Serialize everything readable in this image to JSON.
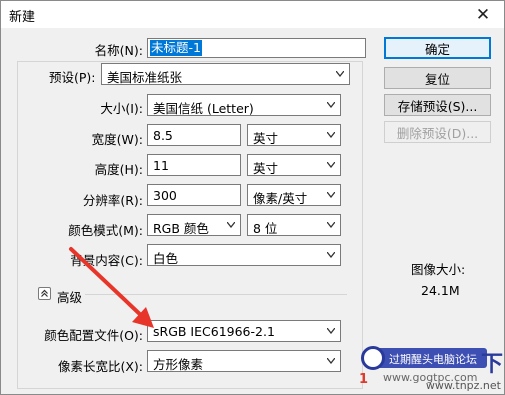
{
  "window": {
    "title": "新建",
    "close_glyph": "✕"
  },
  "form": {
    "name": {
      "label": "名称(N):",
      "value": "未标题-1"
    },
    "preset": {
      "label": "预设(P):",
      "value": "美国标准纸张"
    },
    "size": {
      "label": "大小(I):",
      "value": "美国信纸 (Letter)"
    },
    "width": {
      "label": "宽度(W):",
      "value": "8.5",
      "unit": "英寸"
    },
    "height": {
      "label": "高度(H):",
      "value": "11",
      "unit": "英寸"
    },
    "resolution": {
      "label": "分辨率(R):",
      "value": "300",
      "unit": "像素/英寸"
    },
    "color_mode": {
      "label": "颜色模式(M):",
      "value": "RGB 颜色",
      "depth": "8 位"
    },
    "background": {
      "label": "背景内容(C):",
      "value": "白色"
    },
    "advanced": {
      "label": "高级",
      "icon": "chevron-up-icon"
    },
    "color_profile": {
      "label": "颜色配置文件(O):",
      "value": "sRGB IEC61966-2.1"
    },
    "pixel_aspect": {
      "label": "像素长宽比(X):",
      "value": "方形像素"
    }
  },
  "buttons": {
    "ok": "确定",
    "reset": "复位",
    "save_preset": "存储预设(S)...",
    "delete_preset": "删除预设(D)..."
  },
  "image_size": {
    "label": "图像大小:",
    "value": "24.1M"
  },
  "watermark": {
    "banner": "过期醒头电脑论坛",
    "line1": "www.gogtpc.com",
    "line2": "www.tnpz.net",
    "glyph": "下",
    "digit": "1"
  },
  "colors": {
    "accent": "#0078d7",
    "arrow": "#e8352a"
  }
}
